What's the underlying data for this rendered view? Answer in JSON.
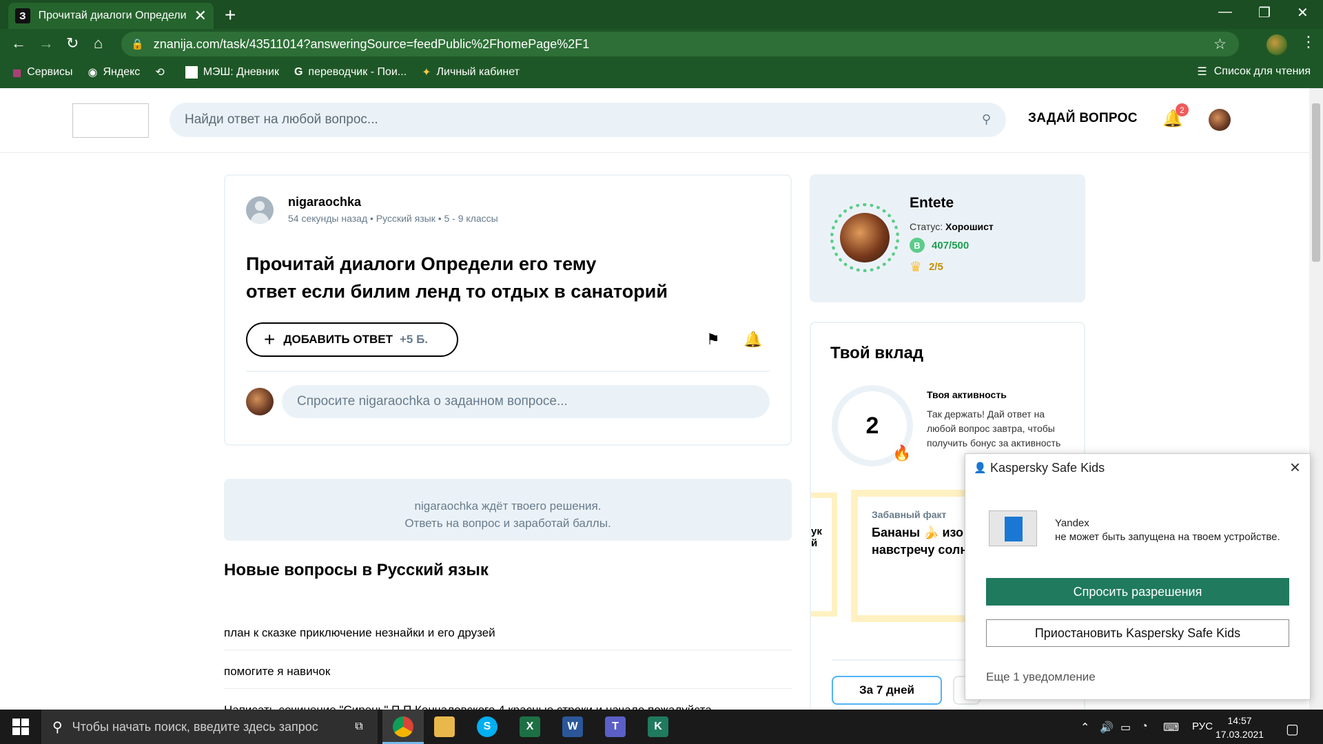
{
  "browser": {
    "tab_title": "Прочитай диалоги Определи ег",
    "tab_favicon": "З",
    "url": "znanija.com/task/43511014?answeringSource=feedPublic%2FhomePage%2F1",
    "bookmarks": [
      "Сервисы",
      "Яндекс",
      "МЭШ: Дневник",
      "переводчик - Пои...",
      "Личный кабинет"
    ],
    "reading_list": "Список для чтения"
  },
  "header": {
    "search_placeholder": "Найди ответ на любой вопрос...",
    "ask_label": "ЗАДАЙ ВОПРОС",
    "notif_count": "2"
  },
  "question": {
    "author": "nigaraochka",
    "meta": "54 секунды назад • Русский язык • 5 - 9 классы",
    "title_line1": "Прочитай диалоги Определи его тему",
    "title_line2": "ответ если билим ленд то отдых в санаторий",
    "add_answer_label": "ДОБАВИТЬ ОТВЕТ",
    "add_answer_points": "+5 Б.",
    "comment_placeholder": "Спросите nigaraochka о заданном вопросе..."
  },
  "waiting": {
    "line1": "nigaraochka ждёт твоего решения.",
    "line2": "Ответь на вопрос и заработай баллы."
  },
  "new_questions": {
    "heading": "Новые вопросы в Русский язык",
    "items": [
      "план к сказке приключение незнайки и его друзей",
      "помогите я навичок",
      "Написать сочинение \"Сирень\" П.П.Кончаловского 4 красные строки и начало пожалуйста"
    ]
  },
  "user": {
    "name": "Entete",
    "status_label": "Статус:",
    "status_value": "Хорошист",
    "points": "407/500",
    "rank": "2/5"
  },
  "contribution": {
    "heading": "Твой вклад",
    "activity_count": "2",
    "activity_title": "Твоя активность",
    "activity_text": "Так держать! Дай ответ на любой вопрос завтра, чтобы получить бонус за активность",
    "fact_left_text": "ук\nй",
    "fact_title": "Забавный факт",
    "fact_text": "Бананы 🍌 изо потому что они навстречу солн",
    "period_label": "За 7 дней"
  },
  "kaspersky": {
    "title": "Kaspersky Safe Kids",
    "app_name": "Yandex",
    "message": "не может быть запущена на твоем устройстве.",
    "primary_label": "Спросить разрешения",
    "secondary_label": "Приостановить Kaspersky Safe Kids",
    "more_label": "Еще 1 уведомление"
  },
  "taskbar": {
    "search_placeholder": "Чтобы начать поиск, введите здесь запрос",
    "lang": "РУС",
    "time": "14:57",
    "date": "17.03.2021"
  },
  "colors": {
    "chrome_green": "#1e5727",
    "brainly_blue_light": "#ebf2f7",
    "kaspersky_green": "#1f7a5e",
    "points_green": "#5ccc8a"
  }
}
